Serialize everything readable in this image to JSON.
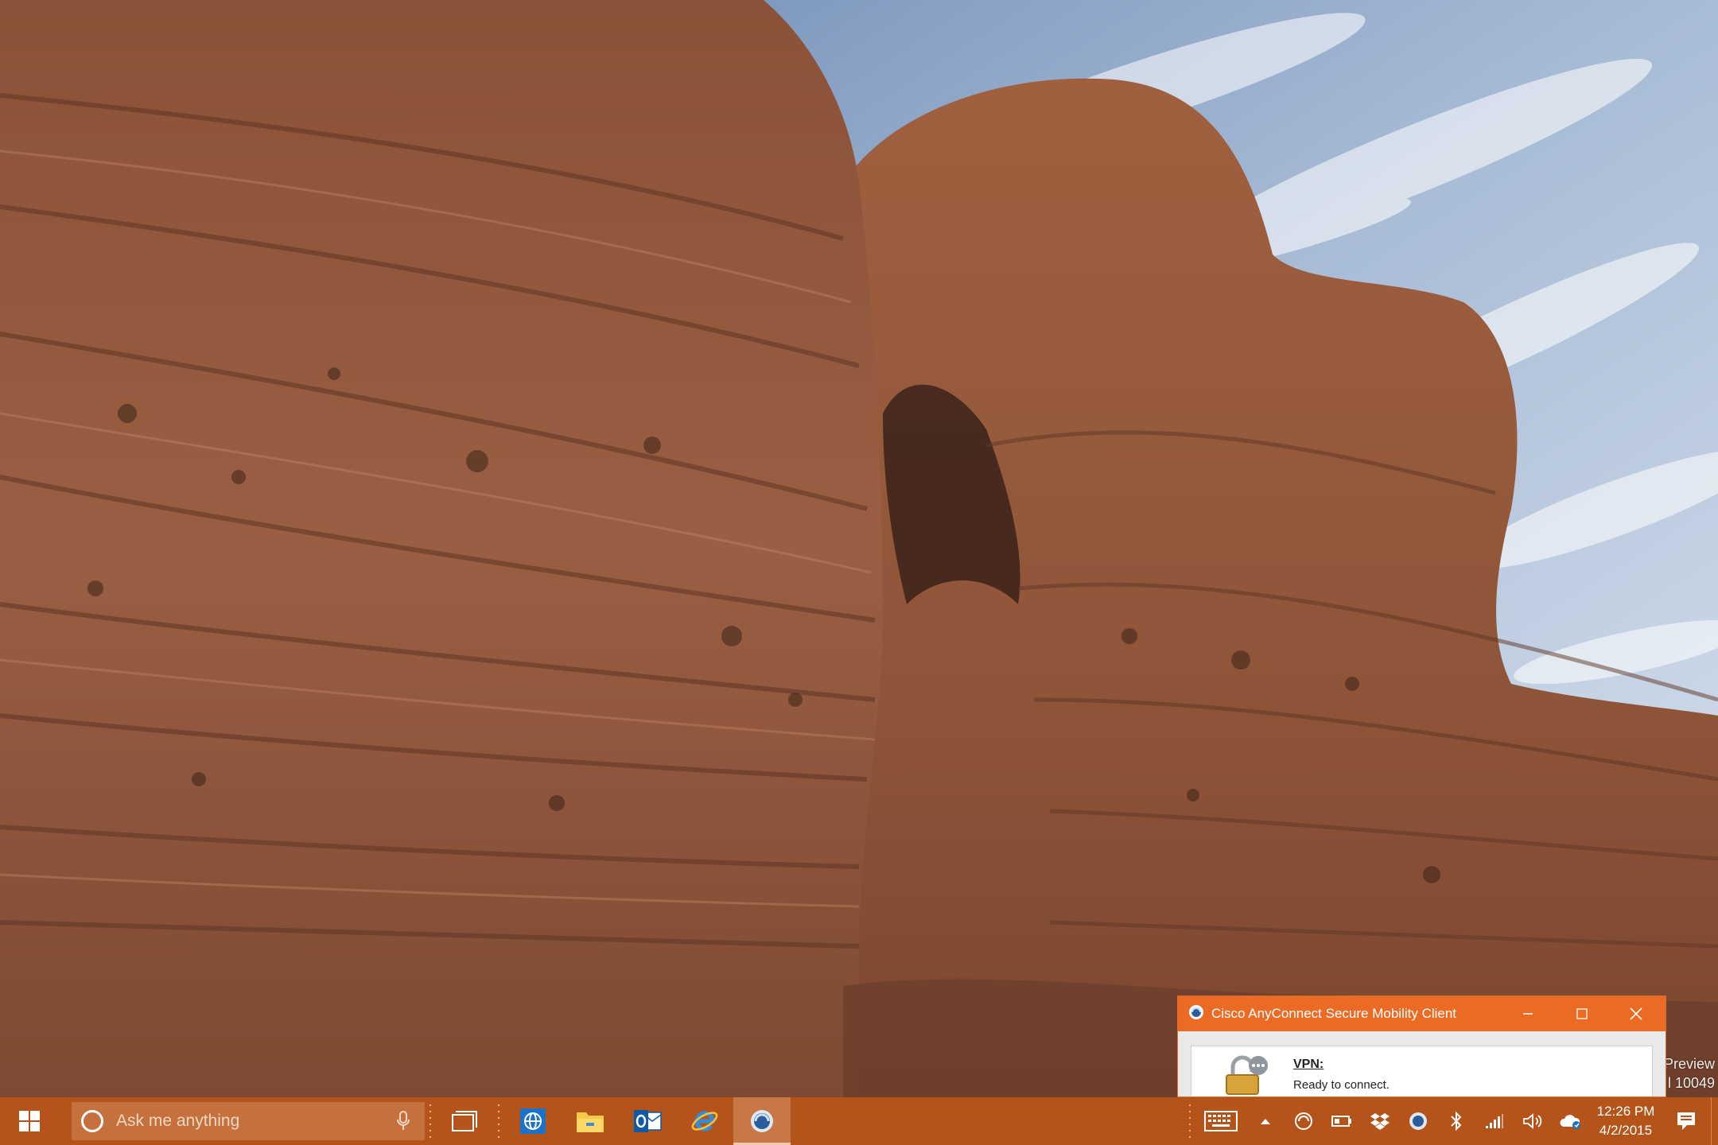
{
  "desktop": {
    "watermark_line1": "Preview",
    "watermark_line2": "l 10049"
  },
  "vpn_window": {
    "title": "Cisco AnyConnect Secure Mobility Client",
    "vpn_label": "VPN:",
    "status": "Ready to connect."
  },
  "taskbar": {
    "search_placeholder": "Ask me anything",
    "apps": [
      {
        "name": "task-view",
        "icon": "task-view-icon"
      },
      {
        "name": "web-app",
        "icon": "globe-icon"
      },
      {
        "name": "file-explorer",
        "icon": "folder-icon"
      },
      {
        "name": "outlook",
        "icon": "outlook-icon"
      },
      {
        "name": "internet-explorer",
        "icon": "ie-icon"
      },
      {
        "name": "cisco-anyconnect",
        "icon": "anyconnect-icon"
      }
    ],
    "tray": [
      "touch-keyboard-icon",
      "chevron-up-icon",
      "anyconnect-tray-icon",
      "battery-icon",
      "dropbox-icon",
      "anyconnect-status-icon",
      "bluetooth-icon",
      "network-icon",
      "volume-icon",
      "onedrive-icon"
    ],
    "time": "12:26 PM",
    "date": "4/2/2015"
  },
  "colors": {
    "taskbar": "#b4541a",
    "accent_titlebar": "#ec6b24",
    "search_box": "#c5713e"
  }
}
